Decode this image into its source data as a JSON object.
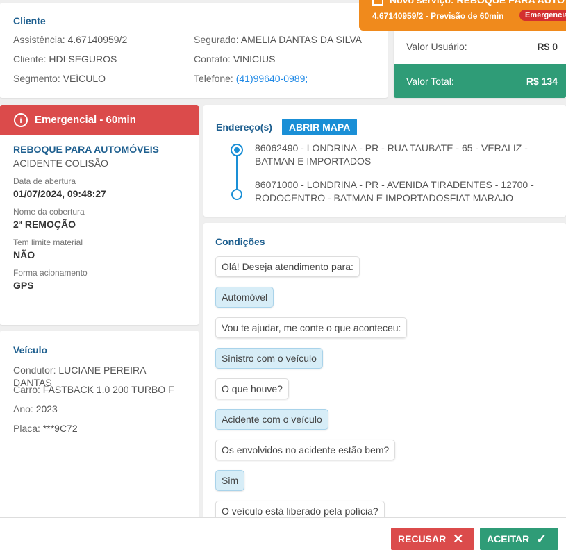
{
  "cliente": {
    "title": "Cliente",
    "left": [
      {
        "label": "Assistência:",
        "value": "4.67140959/2"
      },
      {
        "label": "Cliente:",
        "value": "HDI SEGUROS"
      },
      {
        "label": "Segmento:",
        "value": "VEÍCULO"
      }
    ],
    "right": [
      {
        "label": "Segurado:",
        "value": "AMELIA DANTAS DA SILVA"
      },
      {
        "label": "Contato:",
        "value": "VINICIUS"
      },
      {
        "label": "Telefone:",
        "value": "(41)99640-0989;"
      }
    ]
  },
  "notification": {
    "title": "Novo serviço: REBOQUE PARA AUTO",
    "subtitle": "4.67140959/2 - Previsão de 60min",
    "badge": "Emergencial"
  },
  "values": {
    "user_label": "Valor Usuário:",
    "user_amount": "R$ 0",
    "total_label": "Valor Total:",
    "total_amount": "R$ 134"
  },
  "emergency": {
    "header": "Emergencial - 60min",
    "service": "REBOQUE PARA AUTOMÓVEIS",
    "reason": "ACIDENTE COLISÃO",
    "fields": [
      {
        "label": "Data de abertura",
        "value": "01/07/2024, 09:48:27"
      },
      {
        "label": "Nome da cobertura",
        "value": "2ª REMOÇÃO"
      },
      {
        "label": "Tem limite material",
        "value": "NÃO"
      },
      {
        "label": "Forma acionamento",
        "value": "GPS"
      }
    ]
  },
  "vehicle": {
    "title": "Veículo",
    "rows": [
      {
        "label": "Condutor:",
        "value": "LUCIANE PEREIRA DANTAS"
      },
      {
        "label": "Carro:",
        "value": "FASTBACK 1.0 200 TURBO F"
      },
      {
        "label": "Ano:",
        "value": "2023"
      },
      {
        "label": "Placa:",
        "value": "***9C72"
      }
    ]
  },
  "address": {
    "title": "Endereço(s)",
    "map_button": "ABRIR MAPA",
    "origin": "86062490 - LONDRINA - PR - RUA TAUBATE - 65 - VERALIZ - BATMAN E IMPORTADOS",
    "destination": "86071000 - LONDRINA - PR - AVENIDA TIRADENTES - 12700 - RODOCENTRO - BATMAN E IMPORTADOSFIAT MARAJO"
  },
  "conditions": {
    "title": "Condições",
    "messages": [
      {
        "text": "Olá! Deseja atendimento para:",
        "answer": false
      },
      {
        "text": "Automóvel",
        "answer": true
      },
      {
        "text": "Vou te ajudar, me conte o que aconteceu:",
        "answer": false
      },
      {
        "text": "Sinistro com o veículo",
        "answer": true
      },
      {
        "text": "O que houve?",
        "answer": false
      },
      {
        "text": "Acidente com o veículo",
        "answer": true
      },
      {
        "text": "Os envolvidos no acidente estão bem?",
        "answer": false
      },
      {
        "text": "Sim",
        "answer": true
      },
      {
        "text": "O veículo está liberado pela polícia?",
        "answer": false
      }
    ]
  },
  "footer": {
    "reject_label": "RECUSAR",
    "accept_label": "ACEITAR"
  },
  "colors": {
    "accent": "#1a8fd6",
    "danger": "#db4b4b",
    "success": "#2f9c77",
    "warning": "#f08a1c"
  }
}
